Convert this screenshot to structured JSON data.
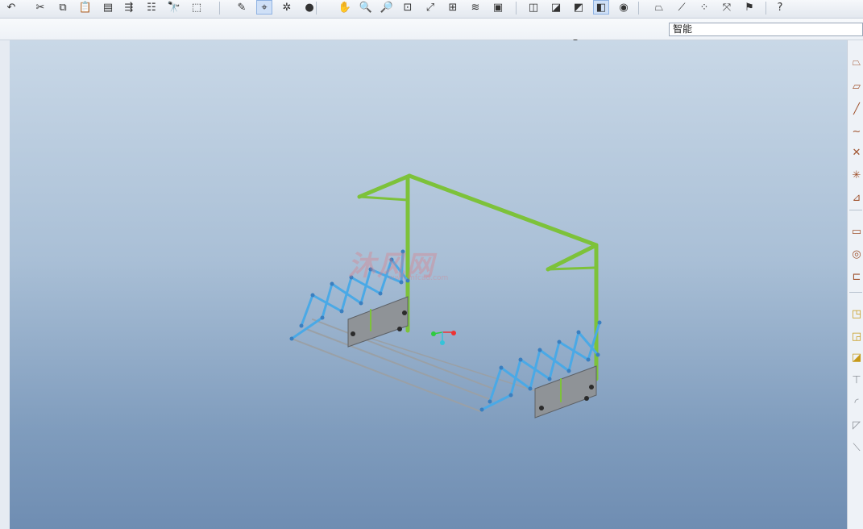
{
  "toolbar": {
    "buttons": [
      {
        "name": "undo-icon",
        "glyph": "↶"
      },
      {
        "name": "cut-icon",
        "glyph": "✂"
      },
      {
        "name": "copy-icon",
        "glyph": "⧉"
      },
      {
        "name": "paste-icon",
        "glyph": "📋"
      },
      {
        "name": "paste-special-icon",
        "glyph": "▤"
      },
      {
        "name": "regenerate-icon",
        "glyph": "⇶"
      },
      {
        "name": "regen-manager-icon",
        "glyph": "☷"
      },
      {
        "name": "find-icon",
        "glyph": "🔭"
      },
      {
        "name": "select-box-icon",
        "glyph": "⬚"
      },
      {
        "name": "sketch-icon",
        "glyph": "✎"
      },
      {
        "name": "datum-display-icon",
        "glyph": "⌖"
      },
      {
        "name": "spin-center-icon",
        "glyph": "✲"
      },
      {
        "name": "shading-icon",
        "glyph": "●"
      },
      {
        "name": "pan-icon",
        "glyph": "✋"
      },
      {
        "name": "zoom-in-icon",
        "glyph": "🔍"
      },
      {
        "name": "zoom-out-icon",
        "glyph": "🔎"
      },
      {
        "name": "refit-icon",
        "glyph": "⊡"
      },
      {
        "name": "reorient-icon",
        "glyph": "⤢"
      },
      {
        "name": "saved-views-icon",
        "glyph": "⊞"
      },
      {
        "name": "layers-icon",
        "glyph": "≋"
      },
      {
        "name": "view-manager-icon",
        "glyph": "▣"
      },
      {
        "name": "wireframe-icon",
        "glyph": "◫"
      },
      {
        "name": "hidden-line-icon",
        "glyph": "◪"
      },
      {
        "name": "no-hidden-icon",
        "glyph": "◩"
      },
      {
        "name": "shaded-icon",
        "glyph": "◧"
      },
      {
        "name": "enhanced-realism-icon",
        "glyph": "◉"
      },
      {
        "name": "datum-planes-icon",
        "glyph": "⏢"
      },
      {
        "name": "datum-axes-icon",
        "glyph": "⟋"
      },
      {
        "name": "datum-points-icon",
        "glyph": "⁘"
      },
      {
        "name": "coordinate-systems-icon",
        "glyph": "⤧"
      },
      {
        "name": "annotation-display-icon",
        "glyph": "⚑"
      },
      {
        "name": "context-help-icon",
        "glyph": "?"
      }
    ]
  },
  "status": {
    "filter_value": "智能",
    "traffic_light_colors": [
      "#d43b2f",
      "#e5c32b",
      "#2fae3b"
    ]
  },
  "watermark": {
    "text": "沐风网",
    "sub": "www.mfcad.com"
  },
  "right_toolbar": {
    "buttons": [
      {
        "name": "datum-plane-tool-icon",
        "glyph": "⏢"
      },
      {
        "name": "datum-plane-icon",
        "glyph": "▱"
      },
      {
        "name": "datum-axis-icon",
        "glyph": "╱"
      },
      {
        "name": "datum-curve-icon",
        "glyph": "∼"
      },
      {
        "name": "datum-point-icon",
        "glyph": "✕"
      },
      {
        "name": "coordinate-system-icon",
        "glyph": "✳"
      },
      {
        "name": "analysis-feature-icon",
        "glyph": "⊿"
      },
      {
        "name": "extrude-icon",
        "glyph": "▭"
      },
      {
        "name": "revolve-icon",
        "glyph": "◎"
      },
      {
        "name": "sweep-icon",
        "glyph": "⊏"
      },
      {
        "name": "hole-icon",
        "glyph": "◳"
      },
      {
        "name": "shell-icon",
        "glyph": "◲"
      },
      {
        "name": "rib-icon",
        "glyph": "◪"
      },
      {
        "name": "draft-icon",
        "glyph": "⊤"
      },
      {
        "name": "round-icon",
        "glyph": "◜"
      },
      {
        "name": "chamfer-icon",
        "glyph": "◸"
      },
      {
        "name": "mirror-icon",
        "glyph": "⟍"
      }
    ]
  },
  "colors": {
    "frame": "#7dc23a",
    "scissor": "#4aa9e6",
    "bracket": "#8f9397",
    "rod": "#9aa0a6",
    "axis_green": "#2ecc40",
    "axis_red": "#e33",
    "axis_cyan": "#35c3d9"
  }
}
